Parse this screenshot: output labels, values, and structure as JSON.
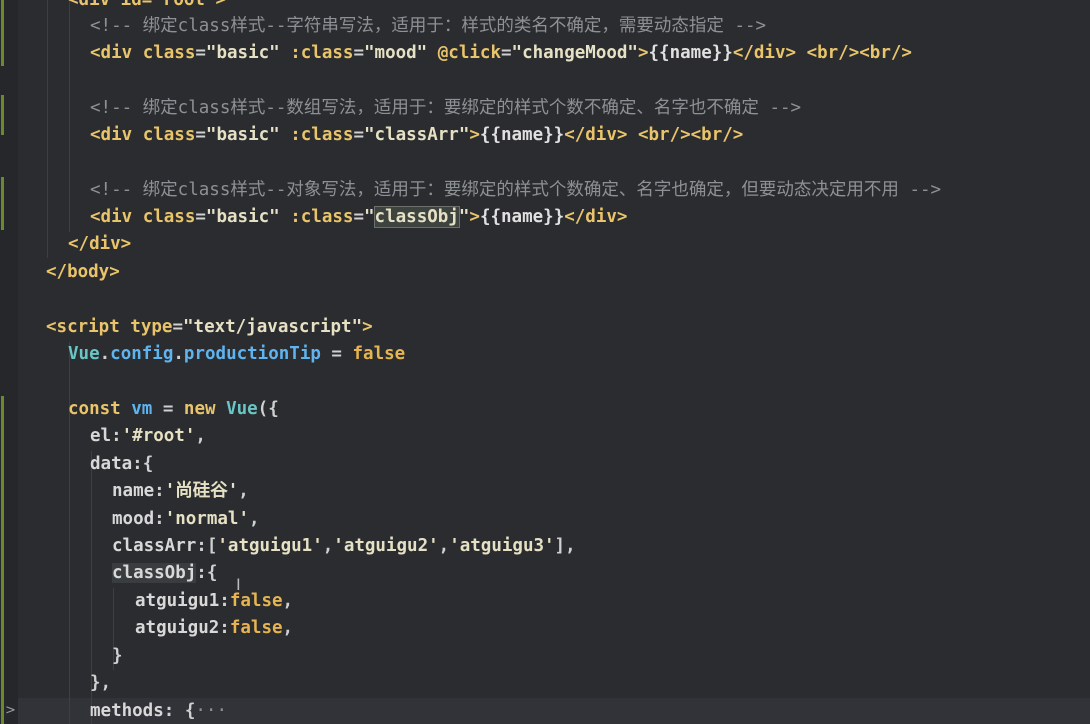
{
  "editor": {
    "lines": [
      {
        "tokens": [
          {
            "t": "<div id=\"root\">",
            "c": "tag"
          }
        ]
      },
      {
        "tokens": [
          {
            "t": "<!-- 绑定class样式--字符串写法，适用于：样式的类名不确定，需要动态指定 -->",
            "c": "comment"
          }
        ]
      },
      {
        "tokens": [
          {
            "t": "<div ",
            "c": "tag"
          },
          {
            "t": "class",
            "c": "attr"
          },
          {
            "t": "=",
            "c": "punct"
          },
          {
            "t": "\"basic\"",
            "c": "str"
          },
          {
            "t": " ",
            "c": "punct"
          },
          {
            "t": ":class",
            "c": "attr"
          },
          {
            "t": "=",
            "c": "punct"
          },
          {
            "t": "\"mood\"",
            "c": "str"
          },
          {
            "t": " ",
            "c": "punct"
          },
          {
            "t": "@click",
            "c": "attr"
          },
          {
            "t": "=",
            "c": "punct"
          },
          {
            "t": "\"changeMood\"",
            "c": "str"
          },
          {
            "t": ">",
            "c": "tag"
          },
          {
            "t": "{{name}}",
            "c": "mus"
          },
          {
            "t": "</div>",
            "c": "tag"
          },
          {
            "t": " ",
            "c": "punct"
          },
          {
            "t": "<br/><br/>",
            "c": "tag"
          }
        ]
      },
      {
        "tokens": []
      },
      {
        "tokens": [
          {
            "t": "<!-- 绑定class样式--数组写法，适用于：要绑定的样式个数不确定、名字也不确定 -->",
            "c": "comment"
          }
        ]
      },
      {
        "tokens": [
          {
            "t": "<div ",
            "c": "tag"
          },
          {
            "t": "class",
            "c": "attr"
          },
          {
            "t": "=",
            "c": "punct"
          },
          {
            "t": "\"basic\"",
            "c": "str"
          },
          {
            "t": " ",
            "c": "punct"
          },
          {
            "t": ":class",
            "c": "attr"
          },
          {
            "t": "=",
            "c": "punct"
          },
          {
            "t": "\"classArr\"",
            "c": "str"
          },
          {
            "t": ">",
            "c": "tag"
          },
          {
            "t": "{{name}}",
            "c": "mus"
          },
          {
            "t": "</div>",
            "c": "tag"
          },
          {
            "t": " ",
            "c": "punct"
          },
          {
            "t": "<br/><br/>",
            "c": "tag"
          }
        ]
      },
      {
        "tokens": []
      },
      {
        "tokens": [
          {
            "t": "<!-- 绑定class样式--对象写法，适用于：要绑定的样式个数确定、名字也确定，但要动态决定用不用 -->",
            "c": "comment"
          }
        ]
      },
      {
        "tokens": [
          {
            "t": "<div ",
            "c": "tag"
          },
          {
            "t": "class",
            "c": "attr"
          },
          {
            "t": "=",
            "c": "punct"
          },
          {
            "t": "\"basic\"",
            "c": "str"
          },
          {
            "t": " ",
            "c": "punct"
          },
          {
            "t": ":class",
            "c": "attr"
          },
          {
            "t": "=",
            "c": "punct"
          },
          {
            "t": "\"",
            "c": "str"
          },
          {
            "t": "classObj",
            "c": "str",
            "hl": "box"
          },
          {
            "t": "\"",
            "c": "str"
          },
          {
            "t": ">",
            "c": "tag"
          },
          {
            "t": "{{name}}",
            "c": "mus"
          },
          {
            "t": "</div>",
            "c": "tag"
          }
        ]
      },
      {
        "tokens": [
          {
            "t": "</div>",
            "c": "tag"
          }
        ]
      },
      {
        "tokens": [
          {
            "t": "</body>",
            "c": "tag"
          }
        ]
      },
      {
        "tokens": []
      },
      {
        "tokens": [
          {
            "t": "<script ",
            "c": "tag"
          },
          {
            "t": "type",
            "c": "attr"
          },
          {
            "t": "=",
            "c": "punct"
          },
          {
            "t": "\"text/javascript\"",
            "c": "str"
          },
          {
            "t": ">",
            "c": "tag"
          }
        ]
      },
      {
        "tokens": [
          {
            "t": "Vue",
            "c": "obj"
          },
          {
            "t": ".",
            "c": "punct"
          },
          {
            "t": "config",
            "c": "field"
          },
          {
            "t": ".",
            "c": "punct"
          },
          {
            "t": "productionTip",
            "c": "field"
          },
          {
            "t": " = ",
            "c": "punct"
          },
          {
            "t": "false",
            "c": "bool"
          }
        ]
      },
      {
        "tokens": []
      },
      {
        "tokens": [
          {
            "t": "const ",
            "c": "kw"
          },
          {
            "t": "vm",
            "c": "field"
          },
          {
            "t": " = ",
            "c": "punct"
          },
          {
            "t": "new ",
            "c": "kw"
          },
          {
            "t": "Vue",
            "c": "obj"
          },
          {
            "t": "({",
            "c": "punct"
          }
        ]
      },
      {
        "tokens": [
          {
            "t": "el",
            "c": "prop"
          },
          {
            "t": ":",
            "c": "punct"
          },
          {
            "t": "'#root'",
            "c": "str"
          },
          {
            "t": ",",
            "c": "punct"
          }
        ]
      },
      {
        "tokens": [
          {
            "t": "data",
            "c": "prop"
          },
          {
            "t": ":{",
            "c": "punct"
          }
        ]
      },
      {
        "tokens": [
          {
            "t": "name",
            "c": "prop"
          },
          {
            "t": ":",
            "c": "punct"
          },
          {
            "t": "'尚硅谷'",
            "c": "str"
          },
          {
            "t": ",",
            "c": "punct"
          }
        ]
      },
      {
        "tokens": [
          {
            "t": "mood",
            "c": "prop"
          },
          {
            "t": ":",
            "c": "punct"
          },
          {
            "t": "'normal'",
            "c": "str"
          },
          {
            "t": ",",
            "c": "punct"
          }
        ]
      },
      {
        "tokens": [
          {
            "t": "classArr",
            "c": "prop"
          },
          {
            "t": ":[",
            "c": "punct"
          },
          {
            "t": "'atguigu1'",
            "c": "str"
          },
          {
            "t": ",",
            "c": "punct"
          },
          {
            "t": "'atguigu2'",
            "c": "str"
          },
          {
            "t": ",",
            "c": "punct"
          },
          {
            "t": "'atguigu3'",
            "c": "str"
          },
          {
            "t": "],",
            "c": "punct"
          }
        ]
      },
      {
        "tokens": [
          {
            "t": "classObj",
            "c": "prop",
            "hl": "soft"
          },
          {
            "t": ":{",
            "c": "punct"
          }
        ]
      },
      {
        "tokens": [
          {
            "t": "atguigu1",
            "c": "prop"
          },
          {
            "t": ":",
            "c": "punct"
          },
          {
            "t": "false",
            "c": "bool"
          },
          {
            "t": ",",
            "c": "punct"
          }
        ]
      },
      {
        "tokens": [
          {
            "t": "atguigu2",
            "c": "prop"
          },
          {
            "t": ":",
            "c": "punct"
          },
          {
            "t": "false",
            "c": "bool"
          },
          {
            "t": ",",
            "c": "punct"
          }
        ]
      },
      {
        "tokens": [
          {
            "t": "}",
            "c": "punct"
          }
        ]
      },
      {
        "tokens": [
          {
            "t": "},",
            "c": "punct"
          }
        ]
      },
      {
        "tokens": [
          {
            "t": "methods",
            "c": "prop"
          },
          {
            "t": ": {",
            "c": "punct"
          },
          {
            "t": "···",
            "c": "ellipsis"
          }
        ]
      }
    ]
  }
}
